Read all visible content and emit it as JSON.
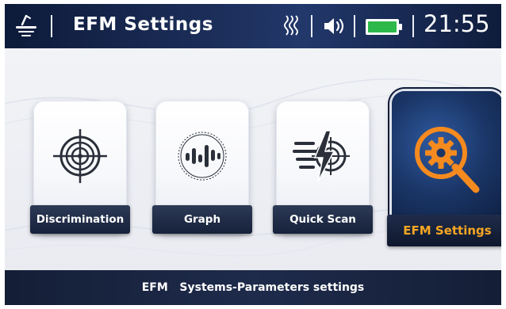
{
  "header": {
    "title": "EFM  Settings",
    "time": "21:55",
    "icons": [
      "detector-logo-icon",
      "signal-icon",
      "speaker-icon",
      "battery-icon"
    ],
    "battery_color": "#2db84a"
  },
  "menu": {
    "items": [
      {
        "label": "Discrimination",
        "icon": "target-icon",
        "selected": false
      },
      {
        "label": "Graph",
        "icon": "waveform-icon",
        "selected": false
      },
      {
        "label": "Quick Scan",
        "icon": "quick-scan-icon",
        "selected": false
      },
      {
        "label": "EFM  Settings",
        "icon": "gear-search-icon",
        "selected": true
      }
    ],
    "selected_label_color": "#f5a623",
    "accent": "#f58a1f"
  },
  "footer": {
    "text": "EFM   Systems-Parameters settings"
  }
}
